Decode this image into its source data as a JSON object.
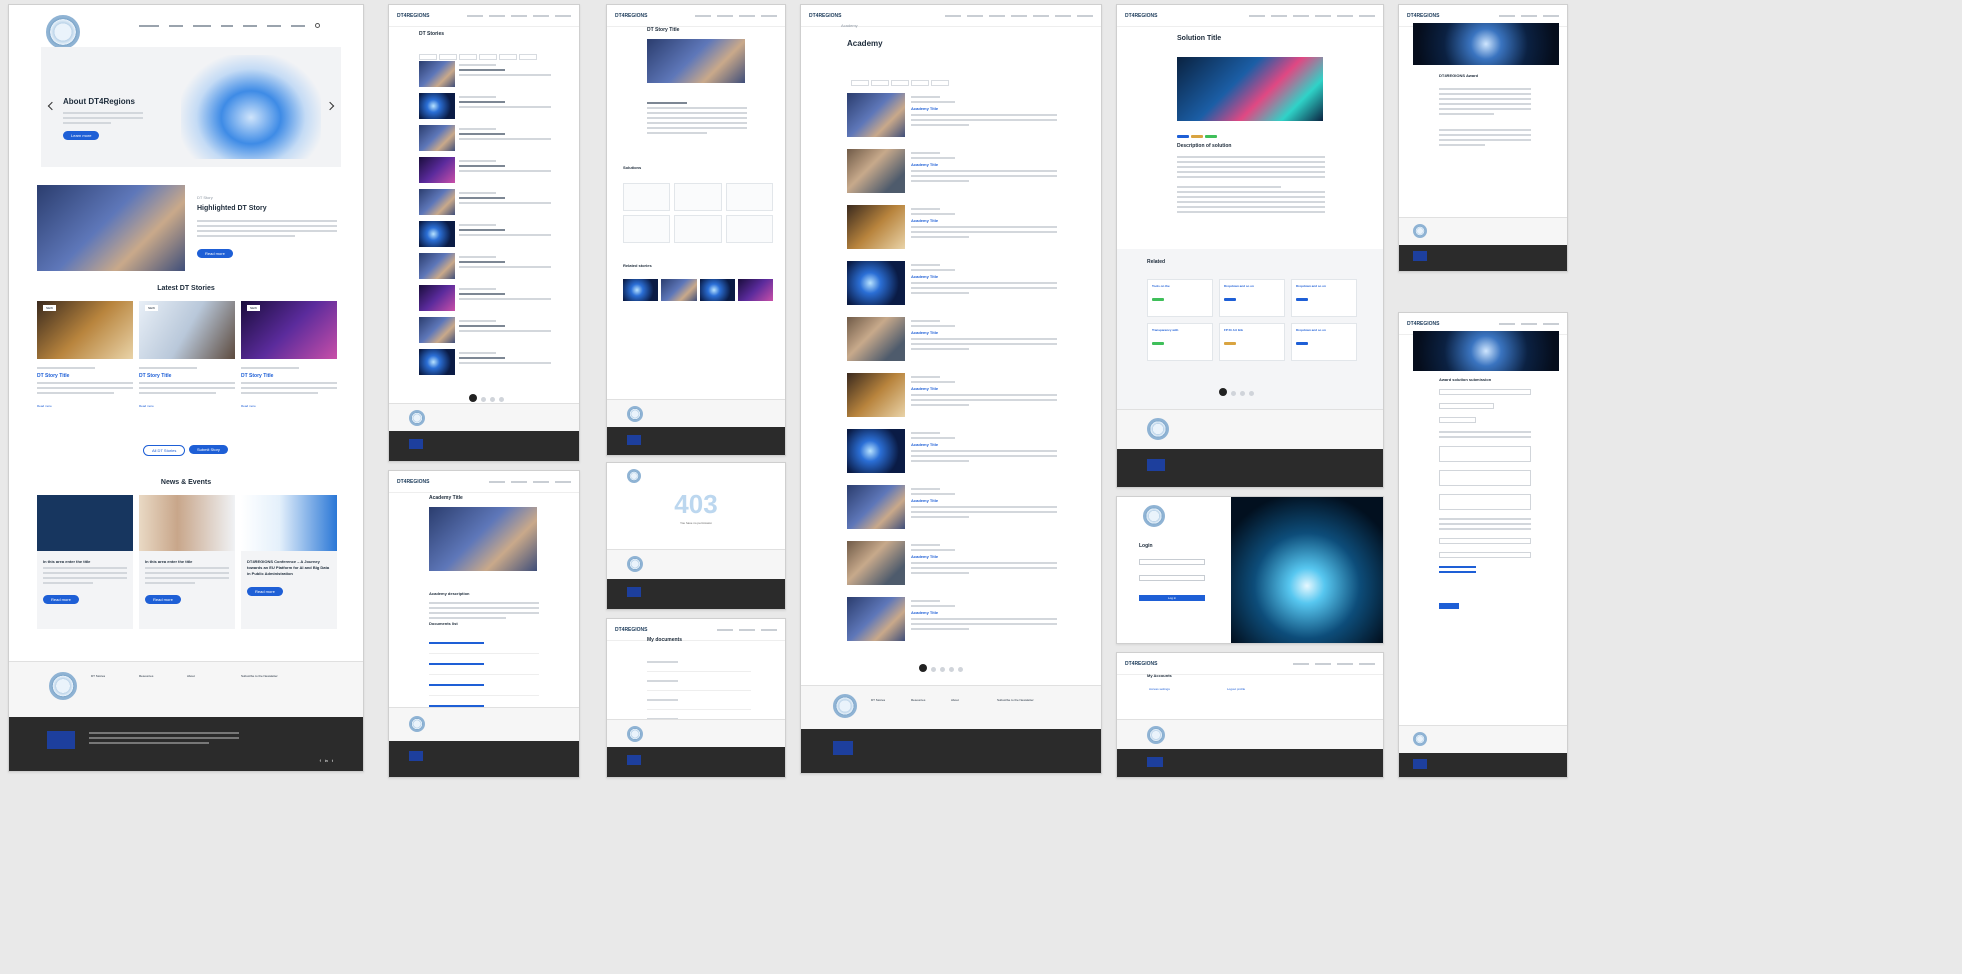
{
  "home": {
    "hero_title": "About DT4Regions",
    "hero_button": "Learn more",
    "highlight_kicker": "DT Story",
    "highlight_title": "Highlighted DT Story",
    "highlight_button": "Read more",
    "latest_title": "Latest DT Stories",
    "story_cards": [
      {
        "badge": "NEW",
        "title": "DT Story Title",
        "link": "Read more"
      },
      {
        "badge": "NEW",
        "title": "DT Story Title",
        "link": "Read more"
      },
      {
        "badge": "NEW",
        "title": "DT Story Title",
        "link": "Read more"
      }
    ],
    "btn_all": "All DT Stories",
    "btn_submit": "Submit Story",
    "news_title": "News & Events",
    "news_cards": [
      {
        "title": "In this area enter the title",
        "button": "Read more"
      },
      {
        "title": "In this area enter the title",
        "button": "Read more"
      },
      {
        "title": "DT4REGIONS Conference – A Journey towards an EU Platform for AI and Big Data in Public Administration",
        "button": "Read more"
      }
    ]
  },
  "stories_list": {
    "title": "DT Stories"
  },
  "story_detail": {
    "title": "DT Story Title",
    "sub_sections": [
      "Solutions",
      "Related stories"
    ]
  },
  "academy": {
    "breadcrumb": "Academy",
    "title": "Academy",
    "item_title": "Academy Title",
    "items_count": 10,
    "pager_current": "1"
  },
  "academy_detail": {
    "title": "Academy Title",
    "section": "Academy description",
    "docs": "Documents list"
  },
  "error_page": {
    "code": "403",
    "message": "You have no permission"
  },
  "my_documents": {
    "title": "My documents"
  },
  "solution": {
    "title": "Solution Title",
    "desc_title": "Description of solution",
    "related_title": "Related",
    "cards": [
      "Tools on the",
      "Dropdown and so on",
      "Dropdown and so on",
      "Transparency with",
      "FP Dr Art link",
      "Dropdown and so on"
    ]
  },
  "login": {
    "title": "Login",
    "button": "Log in"
  },
  "accounts": {
    "title": "My Accounts",
    "items": [
      "Access settings",
      "Logout profile"
    ]
  },
  "award": {
    "title": "DT4REGIONS Award",
    "form_title": "Award solution submission"
  },
  "footer": {
    "cols": [
      "DT Stories",
      "Resources",
      "About",
      "Subscribe to the Newsletter"
    ],
    "brand": "DT4REGIONS",
    "social": [
      "f",
      "in",
      "t"
    ]
  }
}
